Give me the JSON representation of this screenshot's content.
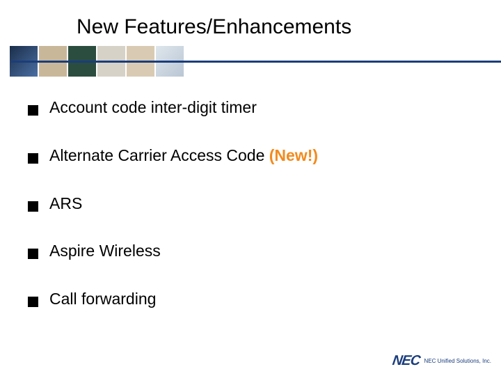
{
  "title": "New Features/Enhancements",
  "items": [
    {
      "text": "Account code inter-digit timer",
      "tag": ""
    },
    {
      "text": "Alternate Carrier Access Code ",
      "tag": "(New!)"
    },
    {
      "text": "ARS",
      "tag": ""
    },
    {
      "text": "Aspire Wireless",
      "tag": ""
    },
    {
      "text": "Call forwarding",
      "tag": ""
    }
  ],
  "logo": {
    "brand": "NEC",
    "sub": "NEC Unified Solutions, Inc."
  }
}
